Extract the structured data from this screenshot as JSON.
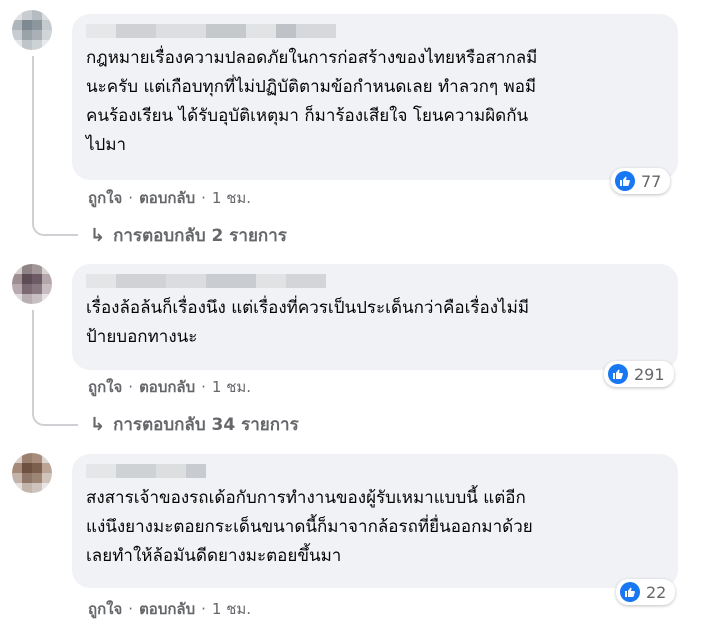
{
  "comments": [
    {
      "text": "กฎหมายเรื่องความปลอดภัยในการก่อสร้างของไทยหรือสากลมี\nนะครับ แต่เกือบทุกที่ไม่ปฏิบัติตามข้อกำหนดเลย ทำลวกๆ พอมี\nคนร้องเรียน ได้รับอุบัติเหตุมา ก็มาร้องเสียใจ โยนความผิดกัน\nไปมา",
      "like_label": "ถูกใจ",
      "reply_label": "ตอบกลับ",
      "time": "1 ชม.",
      "reactions": "77",
      "replies_label": "การตอบกลับ 2 รายการ"
    },
    {
      "text": "เรื่องล้อล้นก็เรื่องนึง แต่เรื่องที่ควรเป็นประเด็นกว่าคือเรื่องไม่มี\nป้ายบอกทางนะ",
      "like_label": "ถูกใจ",
      "reply_label": "ตอบกลับ",
      "time": "1 ชม.",
      "reactions": "291",
      "replies_label": "การตอบกลับ 34 รายการ"
    },
    {
      "text": "สงสารเจ้าของรถเด้อกับการทำงานของผู้รับเหมาแบบนี้ แต่อีก\nแง่นึงยางมะตอยกระเด็นขนาดนี้ก็มาจากล้อรถที่ยื่นออกมาด้วย\nเลยทำให้ล้อมันดีดยางมะตอยขึ้นมา",
      "like_label": "ถูกใจ",
      "reply_label": "ตอบกลับ",
      "time": "1 ชม.",
      "reactions": "22"
    }
  ],
  "colors": {
    "bubble": "#f0f2f5",
    "like_blue": "#1877f2",
    "meta_gray": "#65676b",
    "thread_line": "#ced0d4"
  },
  "icons": {
    "reaction": "like-icon",
    "replies": "reply-arrow-icon"
  }
}
